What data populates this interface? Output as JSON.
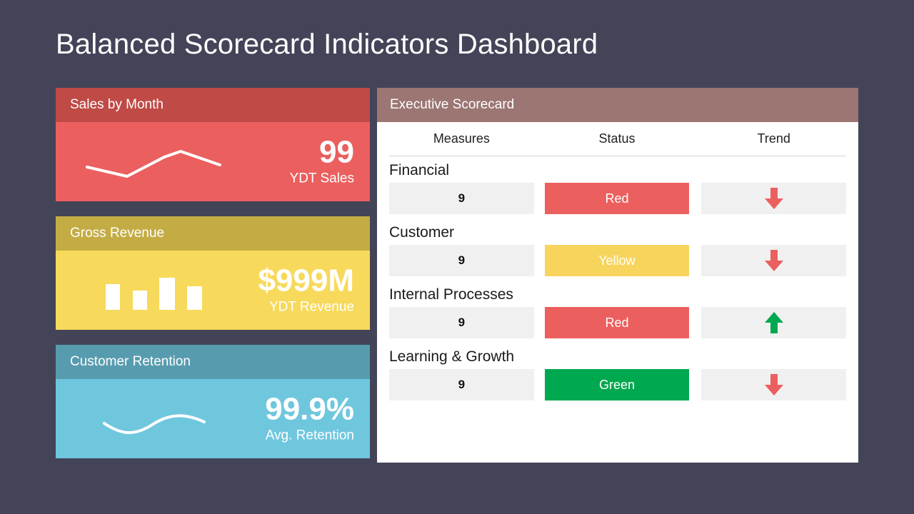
{
  "page": {
    "title": "Balanced Scorecard Indicators Dashboard",
    "background_color": "#434458"
  },
  "kpi_cards": [
    {
      "name": "sales-by-month",
      "title": "Sales by Month",
      "value": "99",
      "label": "YDT Sales",
      "header_color": "#BF4A46",
      "body_color": "#EC5F5F",
      "spark_type": "line",
      "spark_points": [
        38,
        52,
        28,
        34
      ],
      "spark_icon": "line-chart-sparkline"
    },
    {
      "name": "gross-revenue",
      "title": "Gross Revenue",
      "value": "$999M",
      "label": "YDT Revenue",
      "header_color": "#C4AC44",
      "body_color": "#F7D95C",
      "spark_type": "bar",
      "spark_bars": [
        36,
        27,
        45,
        33
      ],
      "spark_icon": "bar-chart-sparkline"
    },
    {
      "name": "customer-retention",
      "title": "Customer Retention",
      "value": "99.9%",
      "label": "Avg. Retention",
      "header_color": "#579CAE",
      "body_color": "#6FC7DE",
      "spark_type": "curve",
      "spark_icon": "curve-sparkline"
    }
  ],
  "scorecard": {
    "title": "Executive Scorecard",
    "header_color": "#9B7672",
    "columns": [
      "Measures",
      "Status",
      "Trend"
    ],
    "groups": [
      {
        "name": "Financial",
        "measure": "9",
        "status": "Red",
        "status_color": "#EC5F5F",
        "trend": "down",
        "trend_icon": "arrow-down-icon",
        "trend_color": "#EC5F5F"
      },
      {
        "name": "Customer",
        "measure": "9",
        "status": "Yellow",
        "status_color": "#F7D45C",
        "trend": "down",
        "trend_icon": "arrow-down-icon",
        "trend_color": "#EC5F5F"
      },
      {
        "name": "Internal Processes",
        "measure": "9",
        "status": "Red",
        "status_color": "#EC5F5F",
        "trend": "up",
        "trend_icon": "arrow-up-icon",
        "trend_color": "#00A84F"
      },
      {
        "name": "Learning & Growth",
        "measure": "9",
        "status": "Green",
        "status_color": "#00A84F",
        "trend": "down",
        "trend_icon": "arrow-down-icon",
        "trend_color": "#EC5F5F"
      }
    ]
  },
  "chart_data": [
    {
      "type": "line",
      "title": "Sales by Month",
      "categories": [
        "1",
        "2",
        "3",
        "4",
        "5"
      ],
      "values": [
        38,
        28,
        33,
        52,
        34
      ],
      "ylabel": "",
      "xlabel": "",
      "grid": false,
      "legend": "none"
    },
    {
      "type": "bar",
      "title": "Gross Revenue",
      "categories": [
        "1",
        "2",
        "3",
        "4"
      ],
      "values": [
        36,
        27,
        45,
        33
      ],
      "ylabel": "",
      "xlabel": "",
      "grid": false,
      "legend": "none"
    },
    {
      "type": "line",
      "title": "Customer Retention",
      "categories": [
        "1",
        "2",
        "3",
        "4",
        "5"
      ],
      "values": [
        30,
        22,
        30,
        42,
        36
      ],
      "ylabel": "",
      "xlabel": "",
      "grid": false,
      "legend": "none"
    }
  ]
}
